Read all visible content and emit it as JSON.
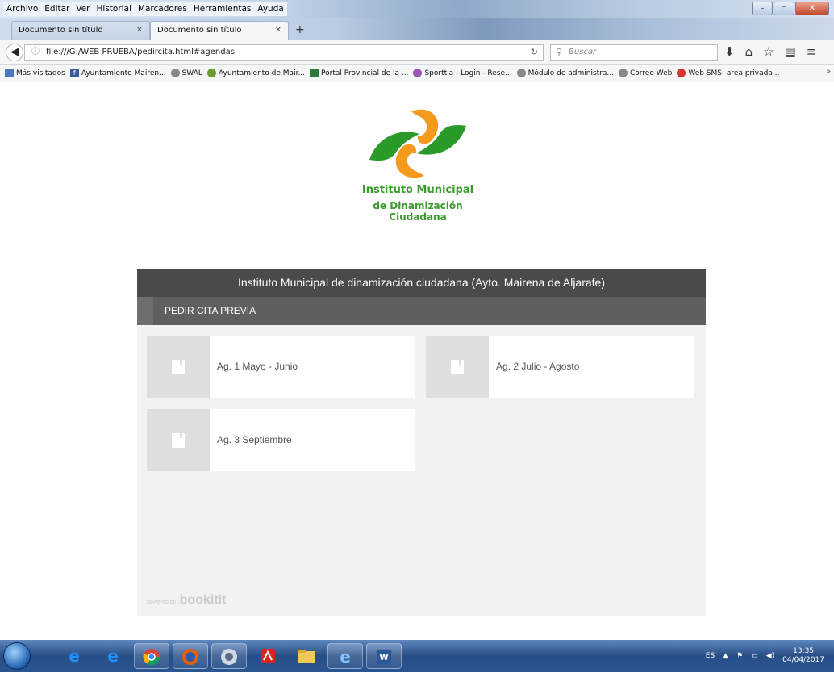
{
  "menu": [
    "Archivo",
    "Editar",
    "Ver",
    "Historial",
    "Marcadores",
    "Herramientas",
    "Ayuda"
  ],
  "tabs": [
    {
      "label": "Documento sin título"
    },
    {
      "label": "Documento sin título"
    }
  ],
  "address": {
    "url": "file:///G:/WEB PRUEBA/pedircita.html#agendas"
  },
  "search": {
    "placeholder": "Buscar"
  },
  "bookmarks": [
    "Más visitados",
    "Ayuntamiento Mairen...",
    "SWAL",
    "Ayuntamiento de Mair...",
    "Portal Provincial de la ...",
    "Sporttia - Login - Rese...",
    "Módulo de administra...",
    "Correo Web",
    "Web SMS: area privada..."
  ],
  "logo": {
    "line1": "Instituto Municipal",
    "line2": "de Dinamización Ciudadana"
  },
  "widget": {
    "header": "Instituto Municipal de dinamización ciudadana (Ayto. Mairena de Aljarafe)",
    "section": "PEDIR CITA PREVIA",
    "agendas": [
      "Ag. 1 Mayo - Junio",
      "Ag. 2 Julio - Agosto",
      "Ag. 3 Septiembre"
    ],
    "powered_by": "powered by",
    "brand": "bookitit"
  },
  "taskbar": {
    "lang": "ES",
    "time": "13:35",
    "date": "04/04/2017"
  },
  "colors": {
    "logo_green": "#3a9a2c",
    "logo_orange": "#f39a1d",
    "header_bg": "#4a4a4a"
  }
}
